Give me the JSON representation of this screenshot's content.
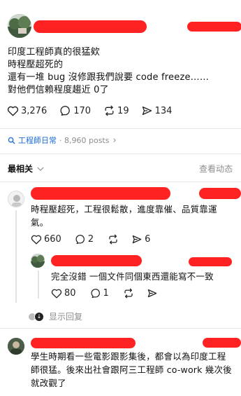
{
  "post": {
    "lines": [
      "印度工程師真的很猛欸",
      "時程壓超死的",
      "還有一堆 bug 沒修跟我們說要 code freeze……",
      "對他們信賴程度趨近 0了"
    ],
    "likes": "3,276",
    "comments": "170",
    "reposts": "19",
    "shares": "134"
  },
  "topic": {
    "name": "工程師日常",
    "posts": "· 8,960 posts",
    "chevron": "›"
  },
  "sort": {
    "label": "最相关",
    "activity": "查看动态"
  },
  "replies": [
    {
      "lines": [
        "時程壓超死，工程很鬆散，進度靠催、品質靠運",
        "氣。"
      ],
      "likes": "660",
      "comments": "2",
      "shares": "6"
    },
    {
      "lines": [
        "完全沒錯 一個文件同個東西還能寫不一致"
      ],
      "likes": "80",
      "comments": "1"
    },
    {
      "lines": [
        "學生時期看一些電影跟影集後，都會以為印度工程",
        "師很猛。後來出社會跟阿三工程師 co-work 幾次後",
        "就改觀了"
      ]
    }
  ],
  "show_replies": "显示回复",
  "colors": {
    "redaction": "#ff2222",
    "topic_blue": "#1d6ed8",
    "muted": "#8e8e8e"
  }
}
